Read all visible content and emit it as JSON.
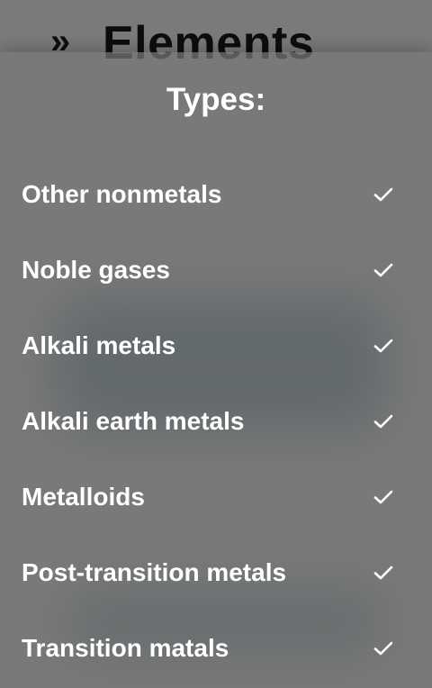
{
  "background_header": {
    "chevron_glyph": "»",
    "title": "Elements"
  },
  "types_panel": {
    "title": "Types:",
    "items": [
      {
        "label": "Other nonmetals",
        "checked": true,
        "icon": "check-icon"
      },
      {
        "label": "Noble gases",
        "checked": true,
        "icon": "check-icon"
      },
      {
        "label": "Alkali metals",
        "checked": true,
        "icon": "check-icon"
      },
      {
        "label": "Alkali earth metals",
        "checked": true,
        "icon": "check-icon"
      },
      {
        "label": "Metalloids",
        "checked": true,
        "icon": "check-icon"
      },
      {
        "label": "Post-transition metals",
        "checked": true,
        "icon": "check-icon"
      },
      {
        "label": "Transition matals",
        "checked": true,
        "icon": "check-icon"
      }
    ]
  },
  "colors": {
    "overlay": "#7a7a7a",
    "text": "#ffffff",
    "background_card": "#1e3a44"
  }
}
